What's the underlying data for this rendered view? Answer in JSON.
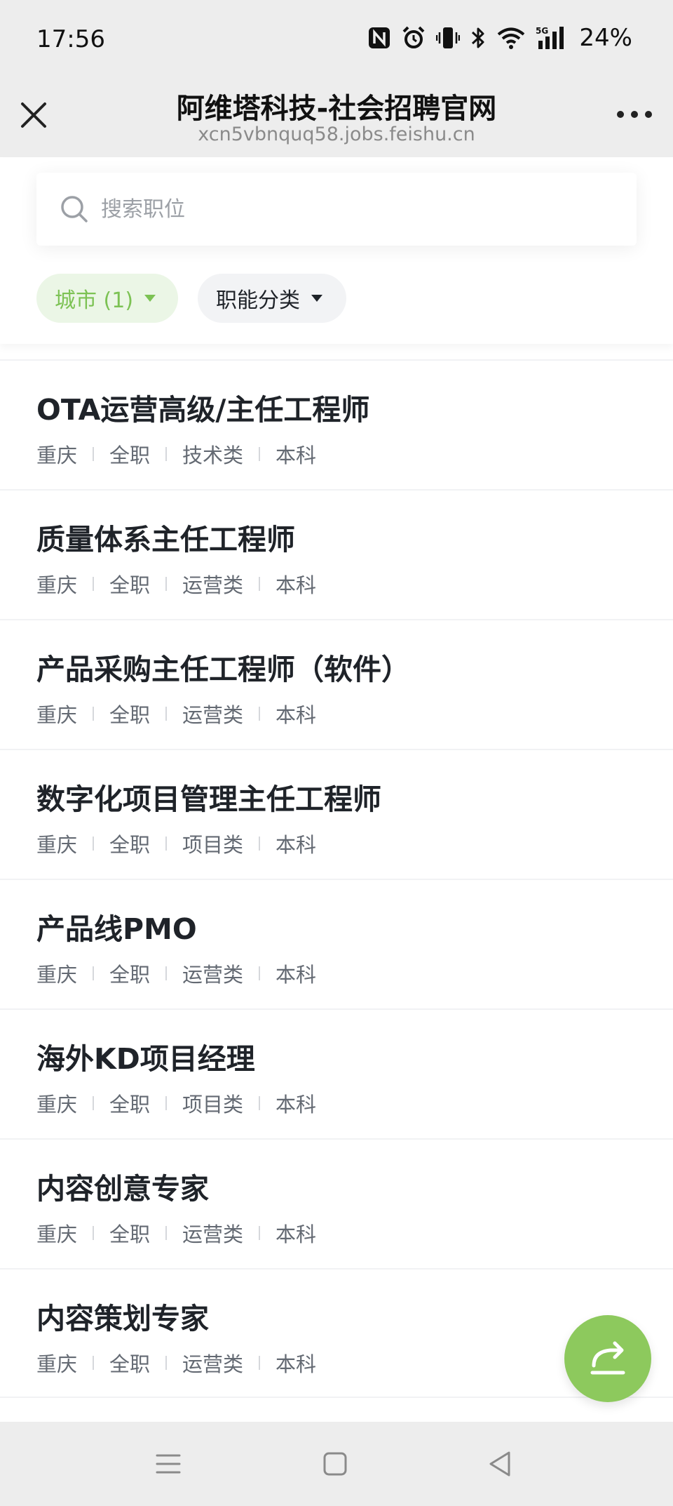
{
  "status_bar": {
    "time": "17:56",
    "battery": "24%",
    "icons": [
      "nfc-icon",
      "alarm-icon",
      "vibrate-icon",
      "bluetooth-icon",
      "wifi-icon",
      "5g-signal-icon"
    ]
  },
  "header": {
    "title": "阿维塔科技-社会招聘官网",
    "url": "xcn5vbnquq58.jobs.feishu.cn",
    "close_icon": "close-icon",
    "more_icon": "more-icon"
  },
  "search": {
    "placeholder": "搜索职位",
    "value": ""
  },
  "filters": {
    "city_label": "城市 (1)",
    "function_label": "职能分类",
    "accent_color": "#7cc254"
  },
  "jobs": [
    {
      "title": "OTA运营高级/主任工程师",
      "city": "重庆",
      "type": "全职",
      "category": "技术类",
      "education": "本科"
    },
    {
      "title": "质量体系主任工程师",
      "city": "重庆",
      "type": "全职",
      "category": "运营类",
      "education": "本科"
    },
    {
      "title": "产品采购主任工程师（软件）",
      "city": "重庆",
      "type": "全职",
      "category": "运营类",
      "education": "本科"
    },
    {
      "title": "数字化项目管理主任工程师",
      "city": "重庆",
      "type": "全职",
      "category": "项目类",
      "education": "本科"
    },
    {
      "title": "产品线PMO",
      "city": "重庆",
      "type": "全职",
      "category": "运营类",
      "education": "本科"
    },
    {
      "title": "海外KD项目经理",
      "city": "重庆",
      "type": "全职",
      "category": "项目类",
      "education": "本科"
    },
    {
      "title": "内容创意专家",
      "city": "重庆",
      "type": "全职",
      "category": "运营类",
      "education": "本科"
    },
    {
      "title": "内容策划专家",
      "city": "重庆",
      "type": "全职",
      "category": "运营类",
      "education": "本科"
    }
  ],
  "fab": {
    "icon": "share-icon",
    "color": "#8dc95d"
  },
  "system_nav": {
    "icons": [
      "menu-icon",
      "home-icon",
      "back-icon"
    ]
  }
}
